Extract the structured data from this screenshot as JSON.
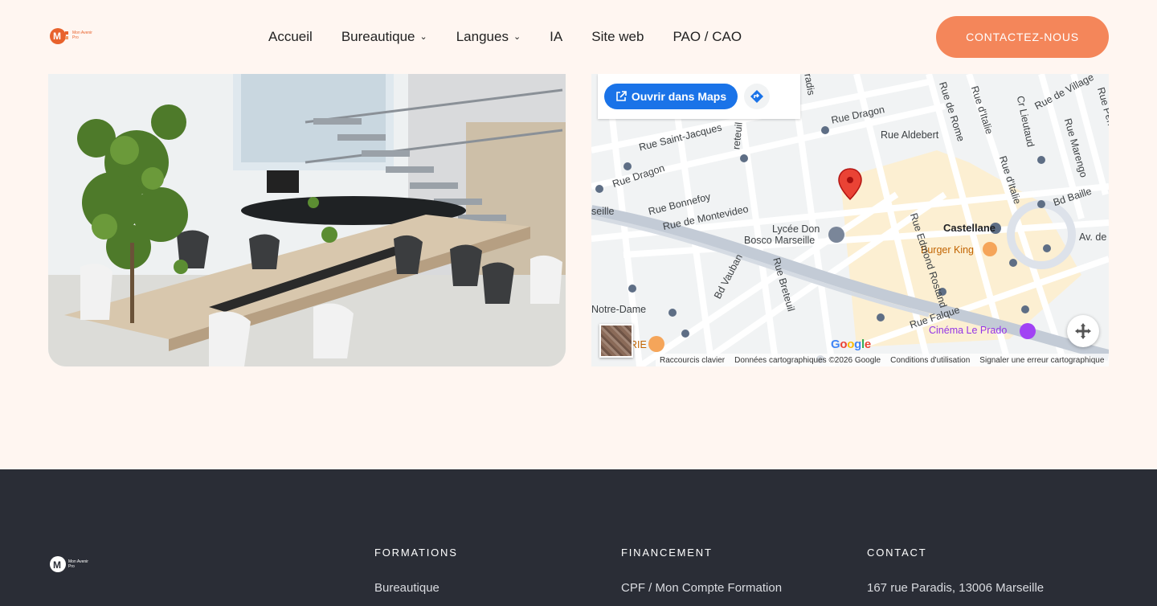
{
  "header": {
    "logo_text": "Mon Avenir Pro",
    "nav": [
      {
        "label": "Accueil",
        "dropdown": false
      },
      {
        "label": "Bureautique",
        "dropdown": true
      },
      {
        "label": "Langues",
        "dropdown": true
      },
      {
        "label": "IA",
        "dropdown": false
      },
      {
        "label": "Site web",
        "dropdown": false
      },
      {
        "label": "PAO / CAO",
        "dropdown": false
      }
    ],
    "cta_label": "CONTACTEZ-NOUS"
  },
  "map": {
    "open_button": "Ouvrir dans Maps",
    "labels": {
      "rue_dragon_1": "Rue Dragon",
      "rue_dragon_2": "Rue Dragon",
      "rue_aldebert": "Rue Aldebert",
      "rue_saint_jacques": "Rue Saint-Jacques",
      "rue_bonnefoy": "Rue Bonnefoy",
      "rue_montevideo": "Rue de Montevideo",
      "rue_de_rome": "Rue de Rome",
      "rue_ditalie_1": "Rue d'Italie",
      "rue_ditalie_2": "Rue d'Italie",
      "cr_lieutaud": "Cr Lieutaud",
      "rue_de_village": "Rue de Village",
      "rue_marengo": "Rue Marengo",
      "rue_perrin_solliers": "Rue Perrin Solliers",
      "bd_baille": "Bd Baille",
      "castellane": "Castellane",
      "burger_king": "Burger King",
      "lycee_don_1": "Lycée Don",
      "lycee_don_2": "Bosco Marseille",
      "rue_edmond_rostand": "Rue Edmond Rostand",
      "bd_vauban": "Bd Vauban",
      "rue_breteuil": "Rue Breteuil",
      "breteuil_top": "reteuil",
      "paradis_top": "radis",
      "seille": "seille",
      "notre_dame": "Notre-Dame",
      "rue_falque": "Rue Falque",
      "cinema": "Cinéma Le Prado",
      "av_de": "Av. de",
      "rie": "RIE"
    },
    "google": "Google",
    "attribution": [
      "Raccourcis clavier",
      "Données cartographiques ©2026 Google",
      "Conditions d'utilisation",
      "Signaler une erreur cartographique"
    ]
  },
  "footer": {
    "logo_text": "Mon Avenir Pro",
    "columns": [
      {
        "title": "FORMATIONS",
        "first_link": "Bureautique"
      },
      {
        "title": "FINANCEMENT",
        "first_link": "CPF / Mon Compte Formation"
      },
      {
        "title": "CONTACT",
        "first_link": "167 rue Paradis, 13006 Marseille"
      }
    ]
  },
  "colors": {
    "accent": "#f4865a",
    "brand": "#e8622c",
    "background": "#fff6f1",
    "footer": "#2a2d36",
    "maps_blue": "#1a73e8"
  }
}
